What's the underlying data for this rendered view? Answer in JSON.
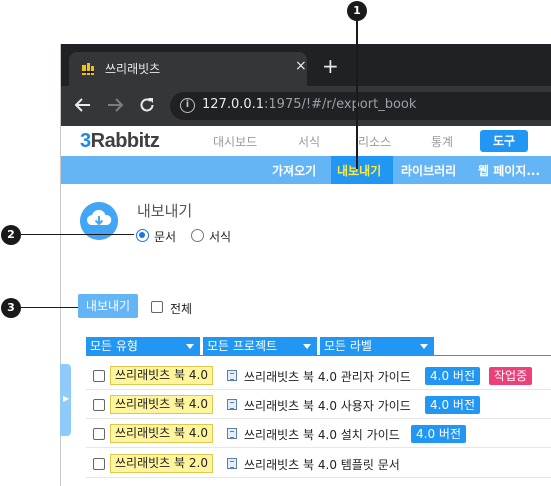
{
  "browser": {
    "tab_title": "쓰리래빗츠",
    "tab_close": "×",
    "new_tab": "+",
    "url_host": "127.0.0.1",
    "url_rest": ":1975/!#/r/export_book"
  },
  "app": {
    "logo_prefix": "3",
    "logo_rest": "Rabbitz",
    "menu": [
      "대시보드",
      "서식",
      "리소스",
      "통계"
    ],
    "menu_active": "도구",
    "subnav": [
      "가져오기",
      "내보내기",
      "라이브러리",
      "웹 페이지..."
    ]
  },
  "content": {
    "title": "내보내기",
    "radio_document": "문서",
    "radio_template": "서식",
    "export_button": "내보내기",
    "all_label": "전체",
    "filters": [
      "모든 유형",
      "모든 프로젝트",
      "모든 라벨"
    ]
  },
  "rows": [
    {
      "book": "쓰리래빗츠 북 4.0",
      "title": "쓰리래빗츠 북 4.0 관리자 가이드",
      "version": "4.0 버전",
      "status": "작업중"
    },
    {
      "book": "쓰리래빗츠 북 4.0",
      "title": "쓰리래빗츠 북 4.0 사용자 가이드",
      "version": "4.0 버전",
      "status": ""
    },
    {
      "book": "쓰리래빗츠 북 4.0",
      "title": "쓰리래빗츠 북 4.0 설치 가이드",
      "version": "4.0 버전",
      "status": ""
    },
    {
      "book": "쓰리래빗츠 북 2.0",
      "title": "쓰리래빗츠 북 4.0 템플릿 문서",
      "version": "",
      "status": ""
    }
  ],
  "callouts": [
    "1",
    "2",
    "3"
  ],
  "colors": {
    "accent": "#2196f3",
    "subnav": "#64b5f6",
    "highlight": "#ffeb3b",
    "status_working": "#ec407a"
  }
}
